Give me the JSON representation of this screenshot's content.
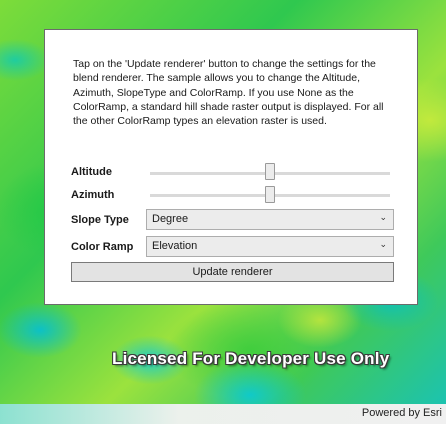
{
  "map": {
    "watermark": "Licensed For Developer Use Only",
    "attribution": "Powered by Esri"
  },
  "panel": {
    "description": "Tap on the 'Update renderer' button to change the settings for the blend renderer. The sample allows you to change the Altitude, Azimuth, SlopeType and ColorRamp. If you use None as the ColorRamp, a standard hill shade raster output is displayed. For all the other ColorRamp types an elevation raster is used.",
    "altitude": {
      "label": "Altitude",
      "value_fraction": 0.5
    },
    "azimuth": {
      "label": "Azimuth",
      "value_fraction": 0.5
    },
    "slope_type": {
      "label": "Slope Type",
      "selected": "Degree"
    },
    "color_ramp": {
      "label": "Color Ramp",
      "selected": "Elevation"
    },
    "update_button_label": "Update renderer"
  }
}
